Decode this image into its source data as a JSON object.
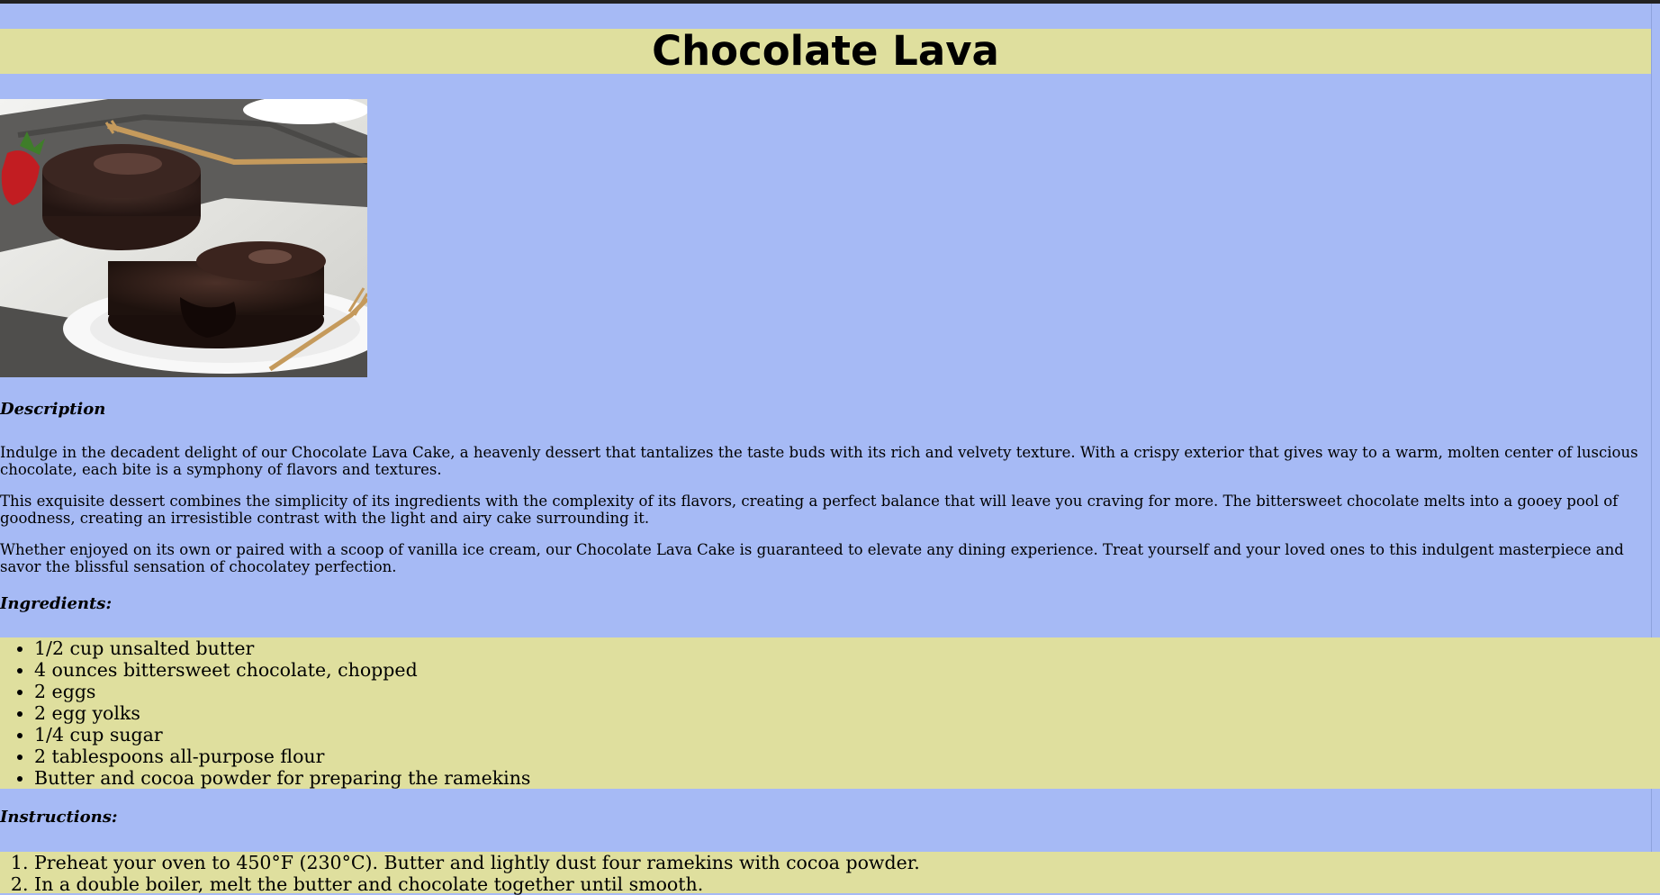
{
  "page": {
    "title": "Chocolate Lava"
  },
  "image": {
    "alt": "Chocolate Lava",
    "icon": "recipe-photo"
  },
  "description": {
    "heading": "Description",
    "paragraphs": [
      "Indulge in the decadent delight of our Chocolate Lava Cake, a heavenly dessert that tantalizes the taste buds with its rich and velvety texture. With a crispy exterior that gives way to a warm, molten center of luscious chocolate, each bite is a symphony of flavors and textures.",
      "This exquisite dessert combines the simplicity of its ingredients with the complexity of its flavors, creating a perfect balance that will leave you craving for more. The bittersweet chocolate melts into a gooey pool of goodness, creating an irresistible contrast with the light and airy cake surrounding it.",
      "Whether enjoyed on its own or paired with a scoop of vanilla ice cream, our Chocolate Lava Cake is guaranteed to elevate any dining experience. Treat yourself and your loved ones to this indulgent masterpiece and savor the blissful sensation of chocolatey perfection."
    ]
  },
  "ingredients": {
    "heading": "Ingredients:",
    "items": [
      "1/2 cup unsalted butter",
      "4 ounces bittersweet chocolate, chopped",
      "2 eggs",
      "2 egg yolks",
      "1/4 cup sugar",
      "2 tablespoons all-purpose flour",
      "Butter and cocoa powder for preparing the ramekins"
    ]
  },
  "instructions": {
    "heading": "Instructions:",
    "steps": [
      "Preheat your oven to 450°F (230°C). Butter and lightly dust four ramekins with cocoa powder.",
      "In a double boiler, melt the butter and chocolate together until smooth."
    ]
  },
  "colors": {
    "background": "#a6baf5",
    "band": "#dfdf9e",
    "text": "#000000"
  }
}
